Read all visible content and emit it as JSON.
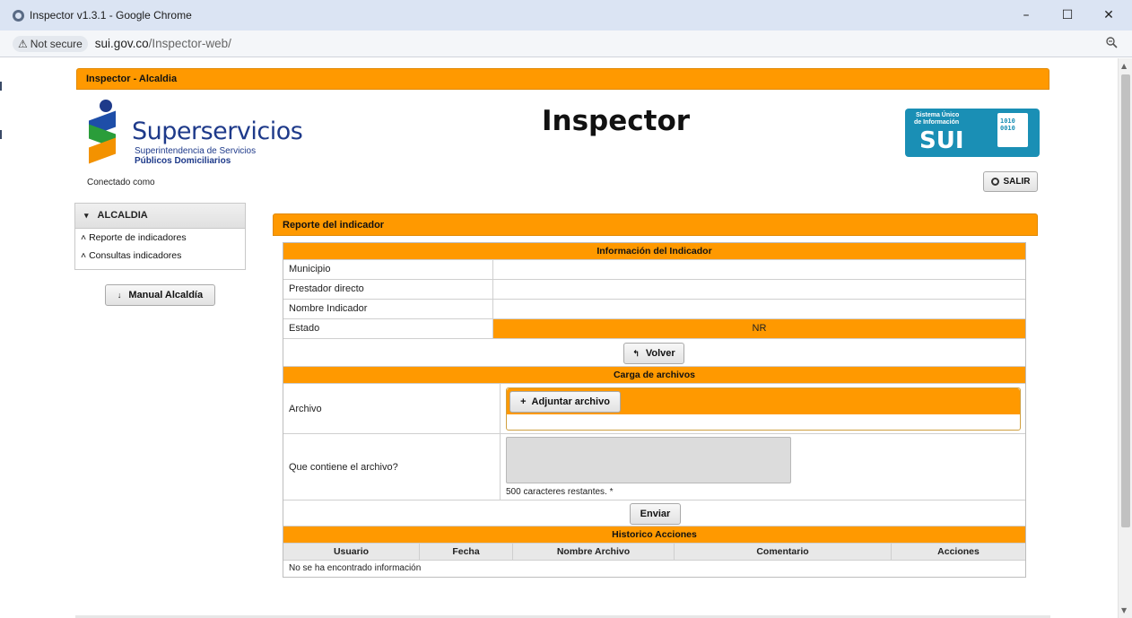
{
  "window": {
    "title": "Inspector v1.3.1 - Google Chrome",
    "minimize": "–",
    "maximize": "☐",
    "close": "✕"
  },
  "address": {
    "security_label": "Not secure",
    "url_host": "sui.gov.co",
    "url_path": "/Inspector-web/"
  },
  "page": {
    "topbar_title": "Inspector - Alcaldia",
    "logo": {
      "brand": "Superservicios",
      "sub1": "Superintendencia de Servicios",
      "sub2": "Públicos Domiciliarios"
    },
    "app_title": "Inspector",
    "sui": {
      "line1": "Sistema Único",
      "line2": "de Información",
      "big": "SUI",
      "doc_text": "1010 0010"
    },
    "connected_as": "Conectado como",
    "logout_label": "SALIR"
  },
  "sidebar": {
    "header": "ALCALDIA",
    "items": [
      {
        "label": "Reporte de indicadores"
      },
      {
        "label": "Consultas indicadores"
      }
    ],
    "manual_button": "Manual Alcaldía"
  },
  "report": {
    "header": "Reporte del indicador",
    "info_section": "Información del Indicador",
    "fields": [
      {
        "label": "Municipio",
        "value": ""
      },
      {
        "label": "Prestador directo",
        "value": ""
      },
      {
        "label": "Nombre Indicador",
        "value": ""
      },
      {
        "label": "Estado",
        "value": "NR"
      }
    ],
    "back_button": "Volver",
    "upload_section": "Carga de archivos",
    "file_label": "Archivo",
    "attach_button": "Adjuntar archivo",
    "content_label": "Que contiene el archivo?",
    "chars_remaining": "500 caracteres restantes. *",
    "send_button": "Enviar",
    "history_section": "Historico Acciones",
    "history_columns": [
      "Usuario",
      "Fecha",
      "Nombre Archivo",
      "Comentario",
      "Acciones"
    ],
    "history_empty": "No se ha encontrado información"
  },
  "colors": {
    "accent": "#ff9900",
    "brand_blue": "#1e3a8a",
    "sui_blue": "#1a8fb5"
  }
}
